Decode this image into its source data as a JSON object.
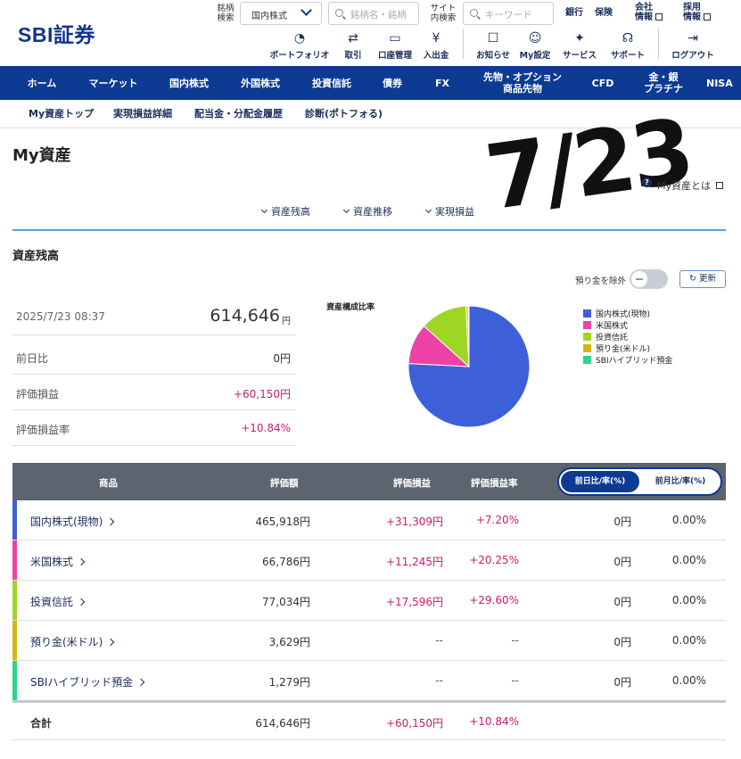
{
  "header": {
    "logo": "SBI証券",
    "stock_search_label": "銘柄\n検索",
    "market_select": "国内株式",
    "stock_search_placeholder": "銘柄名・銘柄",
    "site_search_label": "サイト\n内検索",
    "site_search_placeholder": "キーワード",
    "links": [
      "銀行",
      "保険",
      "会社\n情報",
      "採用\n情報"
    ],
    "tools": [
      {
        "icon": "portfolio-icon",
        "label": "ポートフォリオ"
      },
      {
        "icon": "transfer-icon",
        "label": "取引"
      },
      {
        "icon": "account-icon",
        "label": "口座管理"
      },
      {
        "icon": "deposit-icon",
        "label": "入出金"
      },
      {
        "icon": "notice-icon",
        "label": "お知らせ"
      },
      {
        "icon": "user-icon",
        "label": "My設定"
      },
      {
        "icon": "service-icon",
        "label": "サービス"
      },
      {
        "icon": "support-icon",
        "label": "サポート"
      },
      {
        "icon": "logout-icon",
        "label": "ログアウト"
      }
    ]
  },
  "nav": [
    "ホーム",
    "マーケット",
    "国内株式",
    "外国株式",
    "投資信託",
    "債券",
    "FX",
    "先物・オプション\n商品先物",
    "CFD",
    "金・銀\nプラチナ",
    "NISA"
  ],
  "subnav": [
    "My資産トップ",
    "実現損益詳細",
    "配当金・分配金履歴",
    "診断(ポトフォる)"
  ],
  "page": {
    "title": "My資産",
    "handwritten_note": "7/23",
    "about_link": "My資産とは",
    "anchors": [
      "資産残高",
      "資産推移",
      "実現損益"
    ]
  },
  "balance": {
    "section_title": "資産残高",
    "date": "2025/7/23 08:37",
    "total": "614,646",
    "yen": "円",
    "rows": [
      {
        "label": "前日比",
        "value": "0円",
        "color": "#333333"
      },
      {
        "label": "評価損益",
        "value": "+60,150円",
        "color": "#c71e6a"
      },
      {
        "label": "評価損益率",
        "value": "+10.84%",
        "color": "#c71e6a"
      }
    ],
    "toggle_label": "預り金を除外",
    "refresh_label": "更新"
  },
  "chart_data": {
    "type": "pie",
    "title": "資産構成比率",
    "categories": [
      "国内株式(現物)",
      "米国株式",
      "投資信託",
      "預り金(米ドル)",
      "SBIハイブリッド預金"
    ],
    "values": [
      465918,
      66786,
      77034,
      3629,
      1279
    ],
    "colors": [
      "#3d5fd8",
      "#ee42a6",
      "#9fd624",
      "#d4b612",
      "#2dd488"
    ],
    "legend": "right"
  },
  "table": {
    "headers": [
      "商品",
      "評価額",
      "評価損益",
      "評価損益率"
    ],
    "toggle": {
      "active": "前日比/率(%)",
      "inactive": "前月比/率(%)"
    },
    "rows": [
      {
        "name": "国内株式(現物)",
        "value": "465,918円",
        "pl": "+31,309円",
        "rate": "+7.20%",
        "day": "0円",
        "dayrate": "0.00%",
        "color": "#3d5fd8"
      },
      {
        "name": "米国株式",
        "value": "66,786円",
        "pl": "+11,245円",
        "rate": "+20.25%",
        "day": "0円",
        "dayrate": "0.00%",
        "color": "#ee42a6"
      },
      {
        "name": "投資信託",
        "value": "77,034円",
        "pl": "+17,596円",
        "rate": "+29.60%",
        "day": "0円",
        "dayrate": "0.00%",
        "color": "#9fd624"
      },
      {
        "name": "預り金(米ドル)",
        "value": "3,629円",
        "pl": "--",
        "rate": "--",
        "day": "0円",
        "dayrate": "0.00%",
        "color": "#d4b612"
      },
      {
        "name": "SBIハイブリッド預金",
        "value": "1,279円",
        "pl": "--",
        "rate": "--",
        "day": "0円",
        "dayrate": "0.00%",
        "color": "#2dd488"
      }
    ],
    "total": {
      "name": "合計",
      "value": "614,646円",
      "pl": "+60,150円",
      "rate": "+10.84%"
    }
  }
}
